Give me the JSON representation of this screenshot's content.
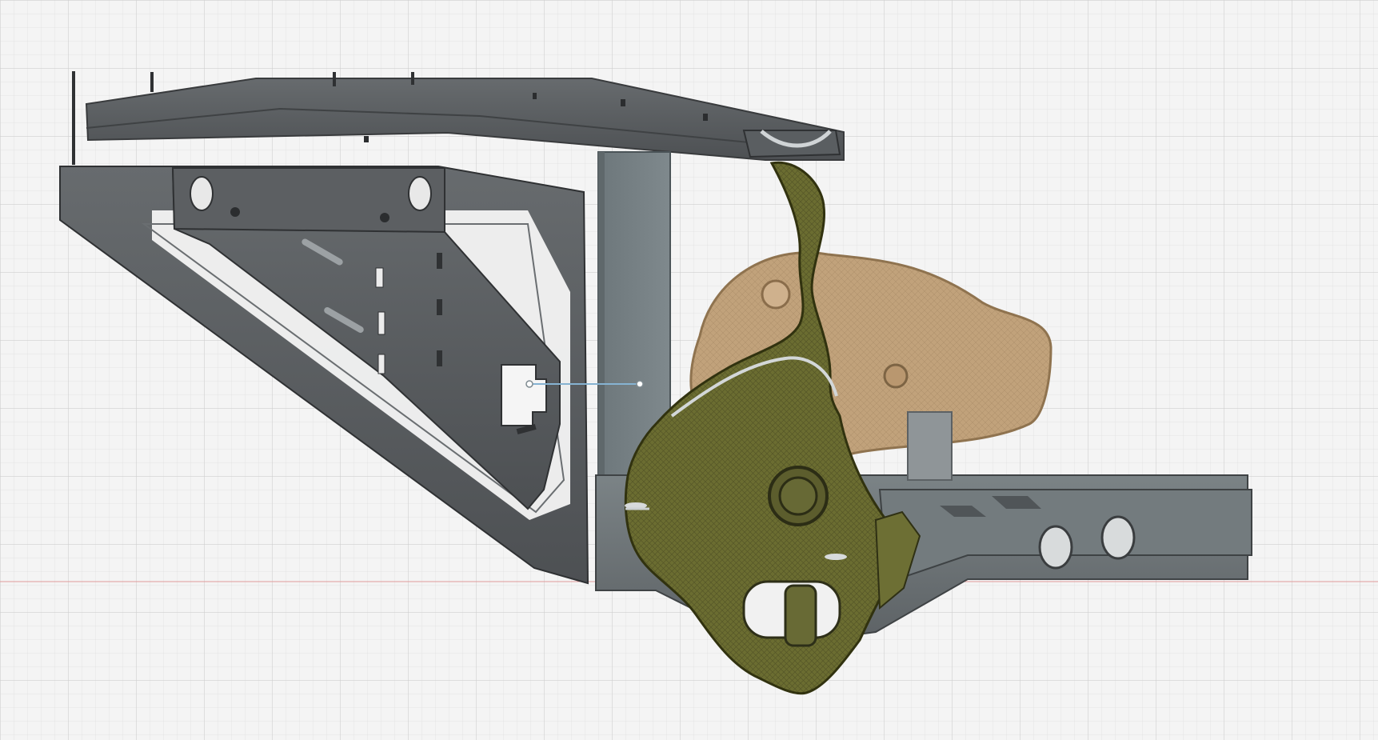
{
  "app": {
    "view": "cad-3d-viewport"
  },
  "scene": {
    "background_color": "#f4f4f4",
    "grid": {
      "visible": true,
      "minor_color": "#e3e3e3",
      "major_color": "#cfcfcf",
      "axis_color": "#e19a9a"
    },
    "components": [
      {
        "name": "upper-control-arm",
        "color": "#5f6366"
      },
      {
        "name": "lower-a-frame-bracket",
        "color": "#5a5d60"
      },
      {
        "name": "gusset-plate",
        "color": "#575a5d"
      },
      {
        "name": "vertical-post",
        "color": "#707b80"
      },
      {
        "name": "lower-crossmember",
        "color": "#6d7376"
      },
      {
        "name": "differential-housing",
        "color": "#c3a47d"
      },
      {
        "name": "hub-knuckle",
        "color": "#6c6d32"
      }
    ],
    "measurement": {
      "visible": true,
      "color": "#86b3d2"
    }
  }
}
